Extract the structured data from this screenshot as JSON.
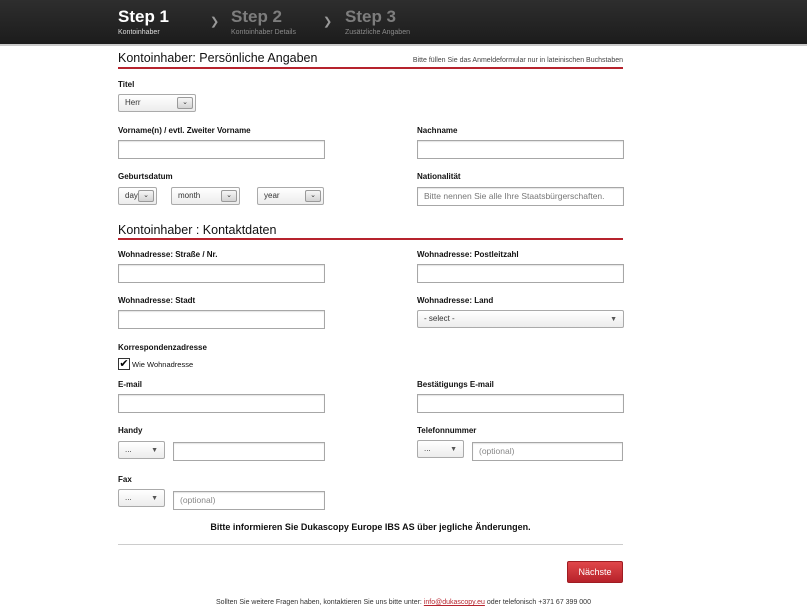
{
  "steps": [
    {
      "label": "Step 1",
      "sub": "Kontoinhaber"
    },
    {
      "label": "Step 2",
      "sub": "Kontoinhaber Details"
    },
    {
      "label": "Step 3",
      "sub": "Zusätzliche Angaben"
    }
  ],
  "section1": {
    "title": "Kontoinhaber: Persönliche Angaben",
    "note": "Bitte füllen Sie das Anmeldeformular nur in lateinischen Buchstaben"
  },
  "fields": {
    "titel_label": "Titel",
    "titel_value": "Herr",
    "vorname_label": "Vorname(n) / evtl. Zweiter Vorname",
    "vorname_value": "",
    "nachname_label": "Nachname",
    "nachname_value": "",
    "geburtsdatum_label": "Geburtsdatum",
    "day_value": "day",
    "month_value": "month",
    "year_value": "year",
    "nationalitaet_label": "Nationalität",
    "nationalitaet_placeholder": "Bitte nennen Sie alle Ihre Staatsbürgerschaften."
  },
  "section2": {
    "title": "Kontoinhaber : Kontaktdaten"
  },
  "contact": {
    "strasse_label": "Wohnadresse: Straße / Nr.",
    "plz_label": "Wohnadresse: Postleitzahl",
    "stadt_label": "Wohnadresse: Stadt",
    "land_label": "Wohnadresse: Land",
    "land_value": "- select -",
    "korrespondenz_label": "Korrespondenzadresse",
    "wie_wohnadresse_label": "Wie Wohnadresse",
    "wie_wohnadresse_checked": true,
    "email_label": "E-mail",
    "email_confirm_label": "Bestätigungs E-mail",
    "handy_label": "Handy",
    "handy_code": "...",
    "telefon_label": "Telefonnummer",
    "telefon_code": "...",
    "telefon_placeholder": "(optional)",
    "fax_label": "Fax",
    "fax_code": "...",
    "fax_placeholder": "(optional)"
  },
  "notice": "Bitte informieren Sie Dukascopy Europe IBS AS über jegliche Änderungen.",
  "next_button": "Nächste",
  "footer": {
    "text_before": "Sollten Sie weitere Fragen haben, kontaktieren Sie uns bitte unter:",
    "email": "info@dukascopy.eu",
    "text_after": "oder telefonisch +371 67 399 000"
  },
  "colors": {
    "accent": "#b6232d",
    "topbar": "#222222"
  }
}
